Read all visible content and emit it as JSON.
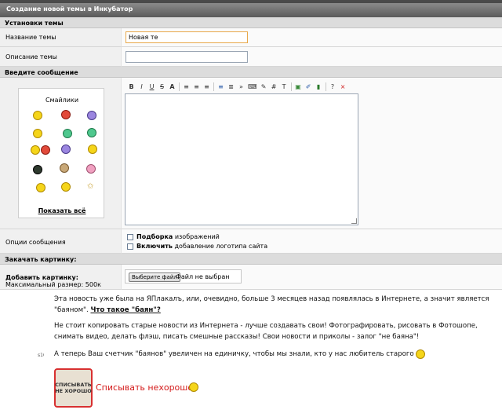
{
  "title": "Создание новой темы в Инкубатор",
  "sections": {
    "settings": "Установки темы",
    "message": "Введите сообщение",
    "upload": "Закачать картинку:"
  },
  "fields": {
    "topic_name_label": "Название темы",
    "topic_name_value": "Новая те",
    "topic_desc_label": "Описание темы",
    "topic_desc_value": ""
  },
  "smilies": {
    "title": "Смайлики",
    "show_all": "Показать всё",
    "icons": [
      "smile-icon",
      "devil-icon",
      "purple-smile-icon",
      "cool-icon",
      "gun-icon",
      "green-smile-icon",
      "wave-icon",
      "fight-icon",
      "tongue-icon",
      "mosh-icon",
      "dog-icon",
      "party-icon",
      "ninja-icon",
      "thumb-icon",
      "dance-icon",
      "hug-icon",
      "laugh-icon",
      "star-icon"
    ]
  },
  "toolbar": [
    "B",
    "I",
    "U",
    "S",
    "A",
    "≡",
    "≡",
    "≡",
    "≡",
    "≣",
    "»",
    "⌨",
    "✎",
    "#",
    "T",
    "▣",
    "✐",
    "▮",
    "?",
    "×"
  ],
  "options": {
    "label": "Опции сообщения",
    "opt1_bold": "Подборка",
    "opt1_rest": " изображений",
    "opt2_bold": "Включить",
    "opt2_rest": " добавление логотипа сайта"
  },
  "upload": {
    "label": "Добавить картинку:",
    "max_size": "Максимальный размер: 500к",
    "button": "Выберите файл",
    "status": "Файл не выбран"
  },
  "overlay": {
    "para1_a": "Эта новость уже была на ЯПлакалъ, или, очевидно, больше 3 месяцев назад появлялась в Интернете, а значит является \"баяном\". ",
    "para1_link": "Что такое \"баян\"?",
    "para2": "Не стоит копировать старые новости из Интернета - лучше создавать свои! Фотографировать, рисовать в Фотошопе, снимать видео, делать флэш, писать смешные рассказы! Свои новости и приколы - залог \"не баяна\"!",
    "para3": "А теперь Ваш счетчик \"баянов\" увеличен на единичку, чтобы мы знали, кто у нас любитель старого",
    "side_num": "s10",
    "stamp_text": "СПИСЫВАТЬ НЕ ХОРОШО",
    "caption": "Списывать нехорошо"
  }
}
